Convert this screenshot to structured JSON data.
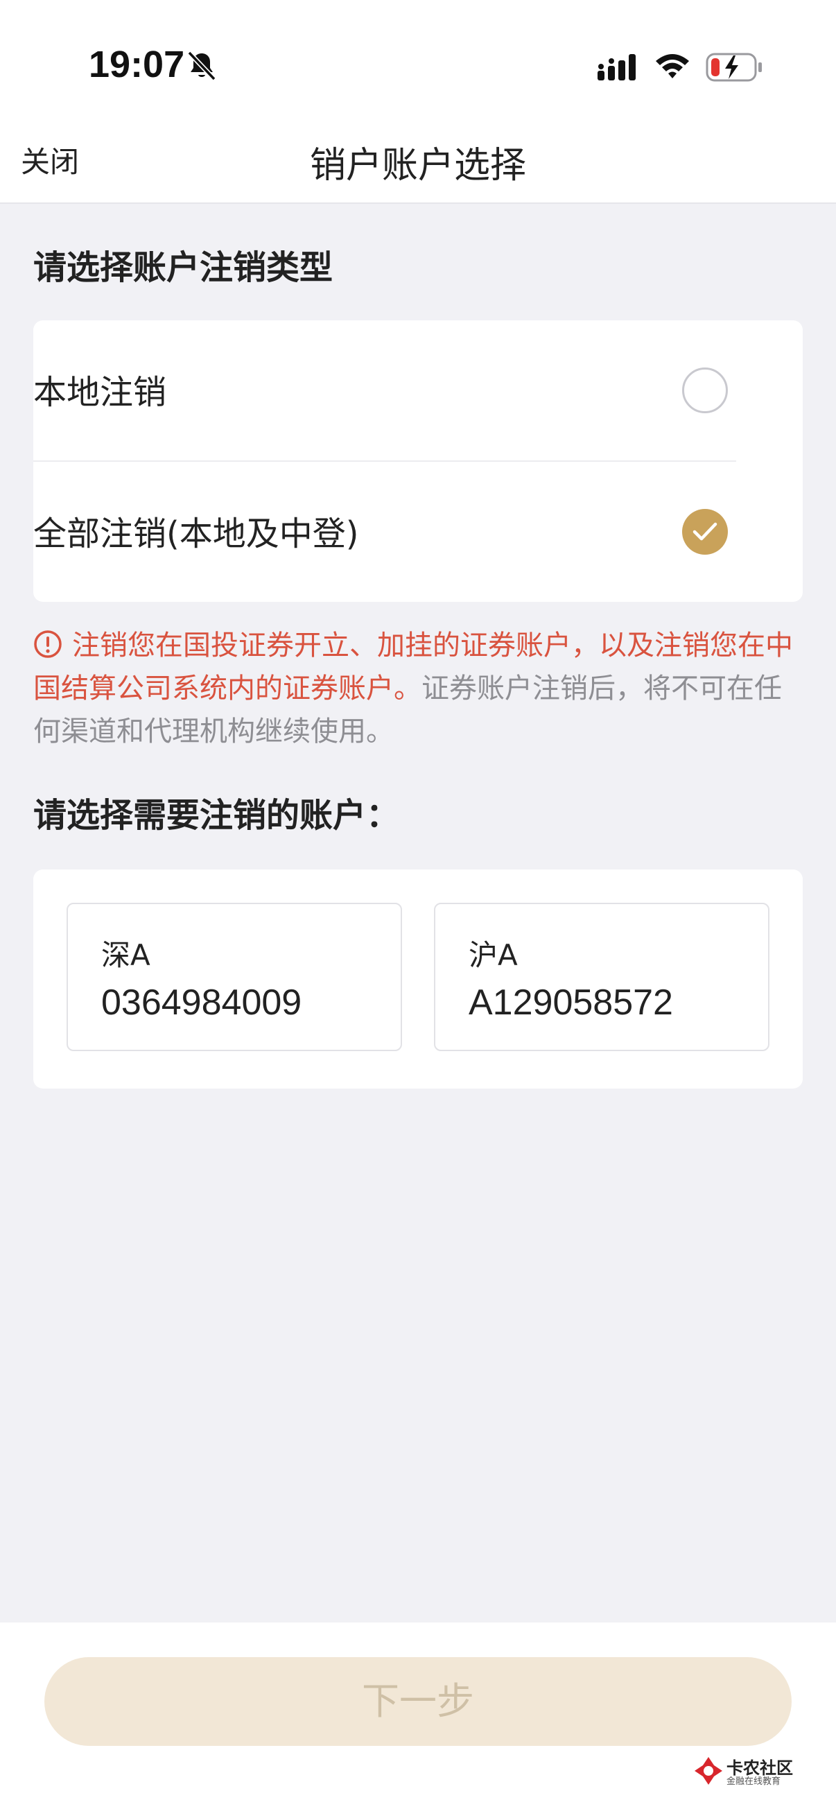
{
  "status_bar": {
    "time": "19:07"
  },
  "nav": {
    "close_label": "关闭",
    "title": "销户账户选择"
  },
  "cancel_type": {
    "section_title": "请选择账户注销类型",
    "options": [
      {
        "label": "本地注销",
        "selected": false
      },
      {
        "label": "全部注销(本地及中登)",
        "selected": true
      }
    ]
  },
  "notice": {
    "highlight": "注销您在国投证券开立、加挂的证券账户，以及注销您在中国结算公司系统内的证券账户。",
    "detail": "证券账户注销后，将不可在任何渠道和代理机构继续使用。"
  },
  "accounts": {
    "section_title": "请选择需要注销的账户：",
    "items": [
      {
        "type": "深A",
        "number": "0364984009"
      },
      {
        "type": "沪A",
        "number": "A129058572"
      }
    ]
  },
  "footer": {
    "next_label": "下一步"
  },
  "watermark": {
    "name": "卡农社区",
    "subtitle": "金融在线教育"
  },
  "colors": {
    "accent": "#c9a25a",
    "warning": "#d9533f",
    "background": "#f1f1f5"
  }
}
